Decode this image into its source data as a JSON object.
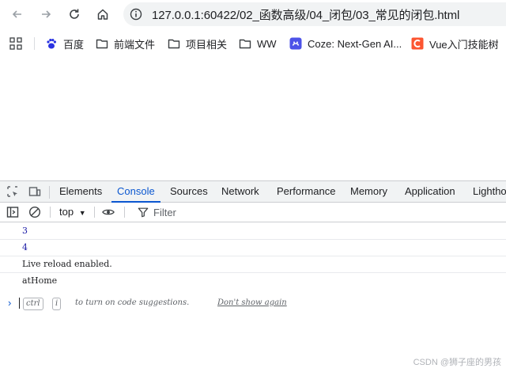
{
  "browser": {
    "url": "127.0.0.1:60422/02_函数高级/04_闭包/03_常见的闭包.html"
  },
  "bookmarks": [
    {
      "label": "百度",
      "icon": "baidu-icon"
    },
    {
      "label": "前端文件",
      "icon": "folder-icon"
    },
    {
      "label": "项目相关",
      "icon": "folder-icon"
    },
    {
      "label": "WW",
      "icon": "folder-icon"
    },
    {
      "label": "Coze: Next-Gen AI...",
      "icon": "coze-icon"
    },
    {
      "label": "Vue入门技能树",
      "icon": "csdn-icon"
    }
  ],
  "devtools": {
    "tabs": [
      "Elements",
      "Console",
      "Sources",
      "Network",
      "Performance",
      "Memory",
      "Application",
      "Lighthouse"
    ],
    "active_tab": "Console",
    "context": "top",
    "filter_placeholder": "Filter"
  },
  "console": {
    "messages": [
      {
        "text": "3",
        "type": "number"
      },
      {
        "text": "4",
        "type": "number"
      },
      {
        "text": "Live reload enabled.",
        "type": "log"
      },
      {
        "text": "atHome",
        "type": "log"
      }
    ],
    "prompt": {
      "key1": "ctrl",
      "key2": "i",
      "hint": "to turn on code suggestions.",
      "dismiss": "Don't show again"
    }
  },
  "watermark": "CSDN @狮子座的男孩",
  "colors": {
    "accent": "#0b57d0",
    "number": "#1a1aa6",
    "coze": "#4d53e8",
    "csdn": "#fc5531",
    "baidu": "#2932e1"
  }
}
